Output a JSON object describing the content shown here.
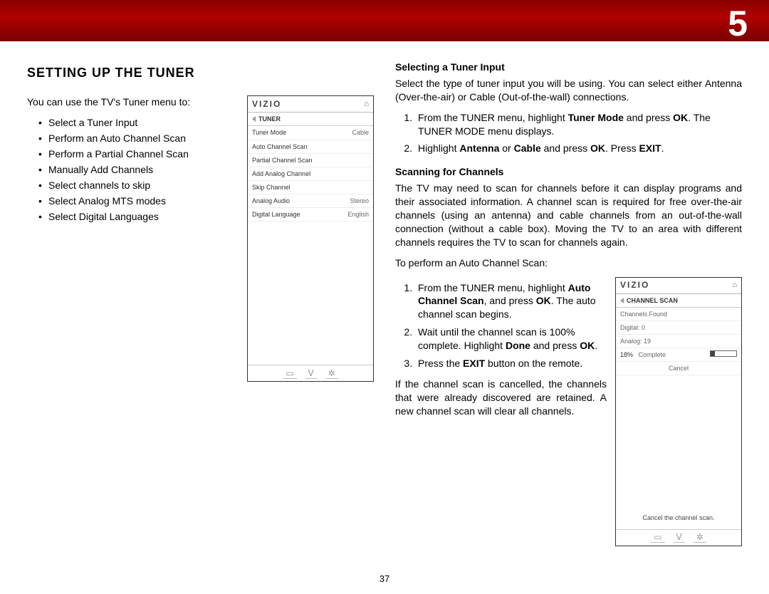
{
  "chapter": "5",
  "page_number": "37",
  "heading": "SETTING UP THE TUNER",
  "intro": "You can use the TV's Tuner menu to:",
  "bullets": [
    "Select a Tuner Input",
    "Perform an Auto Channel Scan",
    "Perform a Partial Channel Scan",
    "Manually Add Channels",
    "Select channels to skip",
    "Select Analog MTS modes",
    "Select Digital Languages"
  ],
  "screen1": {
    "brand": "VIZIO",
    "title": "TUNER",
    "rows": [
      {
        "l": "Tuner Mode",
        "r": "Cable"
      },
      {
        "l": "Auto Channel Scan",
        "r": ""
      },
      {
        "l": "Partial Channel Scan",
        "r": ""
      },
      {
        "l": "Add Analog Channel",
        "r": ""
      },
      {
        "l": "Skip Channel",
        "r": ""
      },
      {
        "l": "Analog Audio",
        "r": "Stereo"
      },
      {
        "l": "Digital Language",
        "r": "English"
      }
    ]
  },
  "sec1_title": "Selecting a Tuner Input",
  "sec1_intro": "Select the type of tuner input you will be using. You can select either Antenna (Over-the-air) or Cable (Out-of-the-wall) connections.",
  "sec1_step1_a": "From the TUNER menu, highlight ",
  "sec1_step1_b": "Tuner Mode",
  "sec1_step1_c": " and press ",
  "sec1_step1_d": "OK",
  "sec1_step1_e": ". The TUNER MODE menu displays.",
  "sec1_step2_a": "Highlight ",
  "sec1_step2_b": "Antenna",
  "sec1_step2_c": " or ",
  "sec1_step2_d": "Cable",
  "sec1_step2_e": " and press ",
  "sec1_step2_f": "OK",
  "sec1_step2_g": ". Press ",
  "sec1_step2_h": "EXIT",
  "sec1_step2_i": ".",
  "sec2_title": "Scanning for Channels",
  "sec2_intro": "The TV may need to scan for channels before it can display programs and their associated information. A channel scan is required for free over-the-air channels (using an antenna) and cable channels from an out-of-the-wall connection (without a cable box). Moving the TV to an area with different channels requires the TV to scan for channels again.",
  "sec2_lead": "To perform an Auto Channel Scan:",
  "sec2_s1_a": "From the TUNER menu, highlight ",
  "sec2_s1_b": "Auto Channel Scan",
  "sec2_s1_c": ", and press ",
  "sec2_s1_d": "OK",
  "sec2_s1_e": ". The auto channel scan begins.",
  "sec2_s2_a": "Wait until the channel scan is 100% complete. Highlight ",
  "sec2_s2_b": "Done",
  "sec2_s2_c": " and press ",
  "sec2_s2_d": "OK",
  "sec2_s2_e": ".",
  "sec2_s3_a": "Press the ",
  "sec2_s3_b": "EXIT",
  "sec2_s3_c": " button on the remote.",
  "sec2_note": "If the channel scan is cancelled, the channels that were already discovered are retained. A new channel scan will clear all channels.",
  "screen2": {
    "brand": "VIZIO",
    "title": "CHANNEL SCAN",
    "row_found": "Channels Found",
    "row_digital": "Digital:   0",
    "row_analog": "Analog: 19",
    "pct": "18%",
    "complete": "Complete",
    "pct_val": 18,
    "cancel": "Cancel",
    "note": "Cancel the channel scan."
  }
}
